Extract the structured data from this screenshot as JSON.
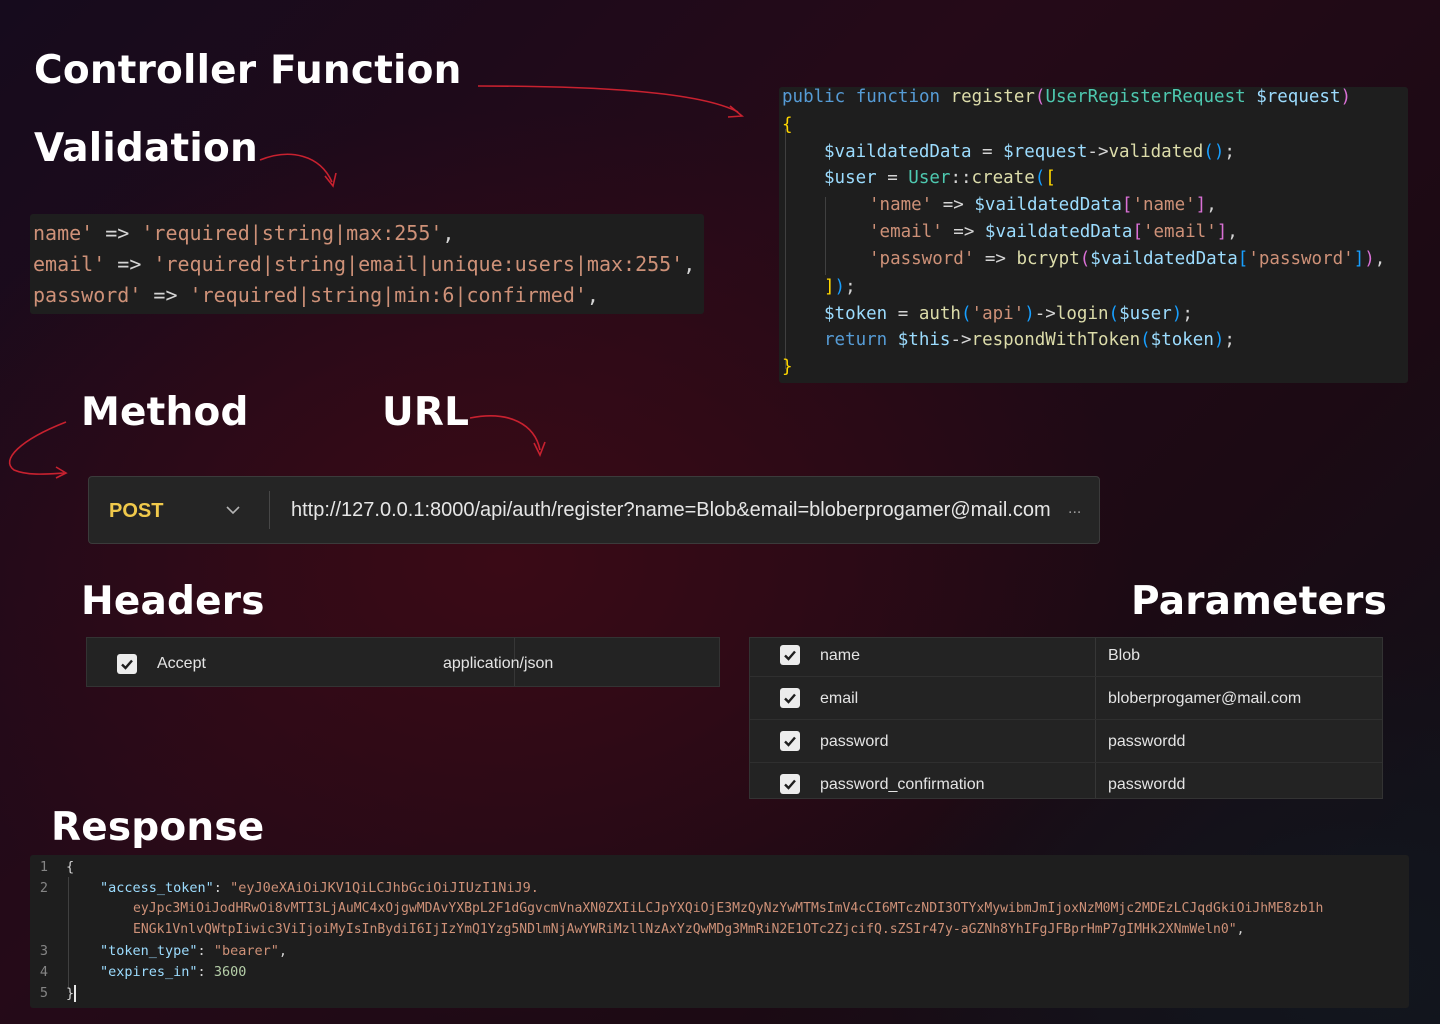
{
  "headings": {
    "controller": "Controller Function",
    "validation": "Validation",
    "method": "Method",
    "url": "URL",
    "headers": "Headers",
    "parameters": "Parameters",
    "response": "Response"
  },
  "validation_code": {
    "line1": {
      "key": "name'",
      "op": " => ",
      "rule": "'required|string|max:255'",
      "end": ","
    },
    "line2": {
      "key": "email'",
      "op": " => ",
      "rule": "'required|string|email|unique:users|max:255'",
      "end": ","
    },
    "line3": {
      "key": "password'",
      "op": " => ",
      "rule": "'required|string|min:6|confirmed'",
      "end": ","
    }
  },
  "controller_code": {
    "l1_public": "public",
    "l1_function": "function",
    "l1_name": "register",
    "l1_open": "(",
    "l1_type": "UserRegisterRequest",
    "l1_param": "$request",
    "l1_close": ")",
    "l2_brace": "{",
    "l3_var": "$vaildatedData",
    "l3_eq": " = ",
    "l3_req": "$request",
    "l3_arrow": "->",
    "l3_method": "validated",
    "l3_parens": "()",
    "l3_end": ";",
    "l4_var": "$user",
    "l4_eq": " = ",
    "l4_cls": "User",
    "l4_sep": "::",
    "l4_method": "create",
    "l4_paren": "(",
    "l4_bracket": "[",
    "l5_key": "'name'",
    "l5_op": " => ",
    "l5_var": "$vaildatedData",
    "l5_open": "[",
    "l5_idx": "'name'",
    "l5_close": "]",
    "l5_end": ",",
    "l6_key": "'email'",
    "l6_op": " => ",
    "l6_var": "$vaildatedData",
    "l6_open": "[",
    "l6_idx": "'email'",
    "l6_close": "]",
    "l6_end": ",",
    "l7_key": "'password'",
    "l7_op": " => ",
    "l7_fn": "bcrypt",
    "l7_paren": "(",
    "l7_var": "$vaildatedData",
    "l7_open": "[",
    "l7_idx": "'password'",
    "l7_close": "]",
    "l7_paren_close": ")",
    "l7_end": ",",
    "l8_bracket": "]",
    "l8_paren": ")",
    "l8_end": ";",
    "l9_var": "$token",
    "l9_eq": " = ",
    "l9_fn": "auth",
    "l9_paren": "(",
    "l9_str": "'api'",
    "l9_paren_close": ")",
    "l9_arrow": "->",
    "l9_method": "login",
    "l9_paren2": "(",
    "l9_arg": "$user",
    "l9_paren2_close": ")",
    "l9_end": ";",
    "l10_return": "return",
    "l10_this": "$this",
    "l10_arrow": "->",
    "l10_method": "respondWithToken",
    "l10_paren": "(",
    "l10_arg": "$token",
    "l10_paren_close": ")",
    "l10_end": ";",
    "l11_brace": "}"
  },
  "request": {
    "method": "POST",
    "url": "http://127.0.0.1:8000/api/auth/register?name=Blob&email=bloberprogamer@mail.com",
    "ellipsis": "..."
  },
  "headers_table": [
    {
      "checked": true,
      "key": "Accept",
      "value": "application/json"
    }
  ],
  "params_table": [
    {
      "checked": true,
      "key": "name",
      "value": "Blob"
    },
    {
      "checked": true,
      "key": "email",
      "value": "bloberprogamer@mail.com"
    },
    {
      "checked": true,
      "key": "password",
      "value": "passwordd"
    },
    {
      "checked": true,
      "key": "password_confirmation",
      "value": "passwordd"
    }
  ],
  "response_code": {
    "line_numbers": [
      "1",
      "2",
      "3",
      "4",
      "5"
    ],
    "l1": "{",
    "l2_key": "\"access_token\"",
    "l2_colon": ": ",
    "l2_val_a": "\"eyJ0eXAiOiJKV1QiLCJhbGciOiJIUzI1NiJ9.",
    "l2_val_b": "eyJpc3MiOiJodHRwOi8vMTI3LjAuMC4xOjgwMDAvYXBpL2F1dGgvcmVnaXN0ZXIiLCJpYXQiOjE3MzQyNzYwMTMsImV4cCI6MTczNDI3OTYxMywibmJmIjoxNzM0Mjc2MDEzLCJqdGkiOiJhME8zb1h",
    "l2_val_c": "ENGk1VnlvQWtpIiwic3ViIjoiMyIsInBydiI6IjIzYmQ1Yzg5NDlmNjAwYWRiMzllNzAxYzQwMDg3MmRiN2E1OTc2ZjcifQ.sZSIr47y-aGZNh8YhIFgJFBprHmP7gIMHk2XNmWeln0\"",
    "l2_end": ",",
    "l3_key": "\"token_type\"",
    "l3_colon": ": ",
    "l3_val": "\"bearer\"",
    "l3_end": ",",
    "l4_key": "\"expires_in\"",
    "l4_colon": ": ",
    "l4_val": "3600",
    "l5": "}"
  },
  "colors": {
    "accent_arrow": "#c8212f",
    "method_post": "#f0c94b",
    "code_bg": "#1e1e1e"
  }
}
